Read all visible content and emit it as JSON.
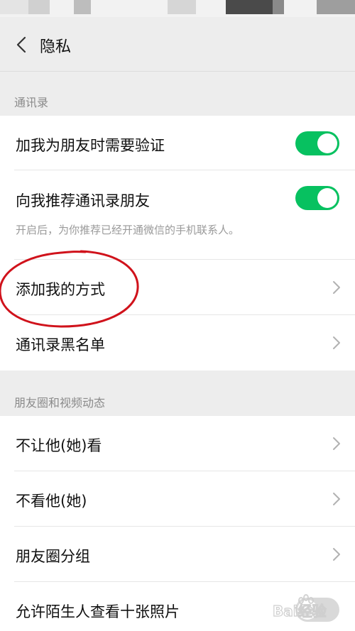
{
  "header": {
    "title": "隐私"
  },
  "sections": {
    "contacts": {
      "title": "通讯录",
      "verify_friend": {
        "label": "加我为朋友时需要验证",
        "enabled": true
      },
      "recommend_contacts": {
        "label": "向我推荐通讯录朋友",
        "hint": "开启后，为你推荐已经开通微信的手机联系人。",
        "enabled": true
      },
      "add_me_methods": {
        "label": "添加我的方式"
      },
      "blacklist": {
        "label": "通讯录黑名单"
      }
    },
    "moments": {
      "title": "朋友圈和视频动态",
      "hide_my_posts": {
        "label": "不让他(她)看"
      },
      "hide_their_posts": {
        "label": "不看他(她)"
      },
      "moments_groups": {
        "label": "朋友圈分组"
      },
      "stranger_ten_photos": {
        "label": "允许陌生人查看十张照片",
        "enabled": false
      }
    }
  },
  "colors": {
    "toggle_on": "#07c160",
    "toggle_off": "#d9d9d9",
    "background": "#ededed",
    "highlight_circle": "#d0121b"
  },
  "icons": {
    "back": "chevron-left-icon",
    "row_arrow": "chevron-right-icon",
    "watermark": "baidu-jingyan-watermark"
  },
  "watermark": {
    "text": "Bai经验"
  }
}
